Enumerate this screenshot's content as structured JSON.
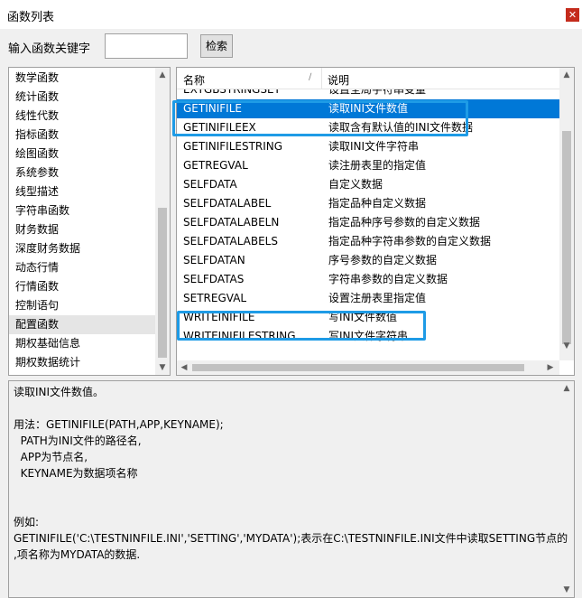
{
  "window": {
    "title": "函数列表",
    "close_symbol": "✕"
  },
  "search": {
    "label": "输入函数关键字",
    "value": "",
    "placeholder": "",
    "button_label": "检索"
  },
  "categories": {
    "items": [
      "数学函数",
      "统计函数",
      "线性代数",
      "指标函数",
      "绘图函数",
      "系统参数",
      "线型描述",
      "字符串函数",
      "财务数据",
      "深度财务数据",
      "动态行情",
      "行情函数",
      "控制语句",
      "配置函数",
      "期权基础信息",
      "期权数据统计"
    ],
    "selected": "配置函数"
  },
  "functions": {
    "columns": {
      "name": "名称",
      "description": "说明"
    },
    "rows": [
      {
        "name": "EXTGBSTRINGSET",
        "description": "设置全局字符串变量"
      },
      {
        "name": "GETINIFILE",
        "description": "读取INI文件数值"
      },
      {
        "name": "GETINIFILEEX",
        "description": "读取含有默认值的INI文件数据"
      },
      {
        "name": "GETINIFILESTRING",
        "description": "读取INI文件字符串"
      },
      {
        "name": "GETREGVAL",
        "description": "读注册表里的指定值"
      },
      {
        "name": "SELFDATA",
        "description": "自定义数据"
      },
      {
        "name": "SELFDATALABEL",
        "description": "指定品种自定义数据"
      },
      {
        "name": "SELFDATALABELN",
        "description": "指定品种序号参数的自定义数据"
      },
      {
        "name": "SELFDATALABELS",
        "description": "指定品种字符串参数的自定义数据"
      },
      {
        "name": "SELFDATAN",
        "description": "序号参数的自定义数据"
      },
      {
        "name": "SELFDATAS",
        "description": "字符串参数的自定义数据"
      },
      {
        "name": "SETREGVAL",
        "description": "设置注册表里指定值"
      },
      {
        "name": "WRITEINIFILE",
        "description": "写INI文件数值"
      },
      {
        "name": "WRITEINIFILESTRING",
        "description": "写INI文件字符串"
      }
    ],
    "selected": "GETINIFILE",
    "highlighted": [
      "GETINIFILE",
      "WRITEINIFILE"
    ]
  },
  "description": {
    "lines": [
      "读取INI文件数值。",
      "",
      "用法：GETINIFILE(PATH,APP,KEYNAME);",
      "  PATH为INI文件的路径名,",
      "  APP为节点名,",
      "  KEYNAME为数据项名称",
      "",
      "",
      "例如:",
      "GETINIFILE('C:\\TESTNINFILE.INI','SETTING','MYDATA');表示在C:\\TESTNINFILE.INI文件中读取SETTING节点的",
      ",项名称为MYDATA的数据."
    ]
  },
  "colors": {
    "selection": "#0078d7",
    "highlight_box": "#1e9be6",
    "close_button": "#c42b1c"
  },
  "icons": {
    "scroll_up": "▲",
    "scroll_down": "▼",
    "scroll_left": "◀",
    "scroll_right": "▶",
    "sort": "∕"
  }
}
